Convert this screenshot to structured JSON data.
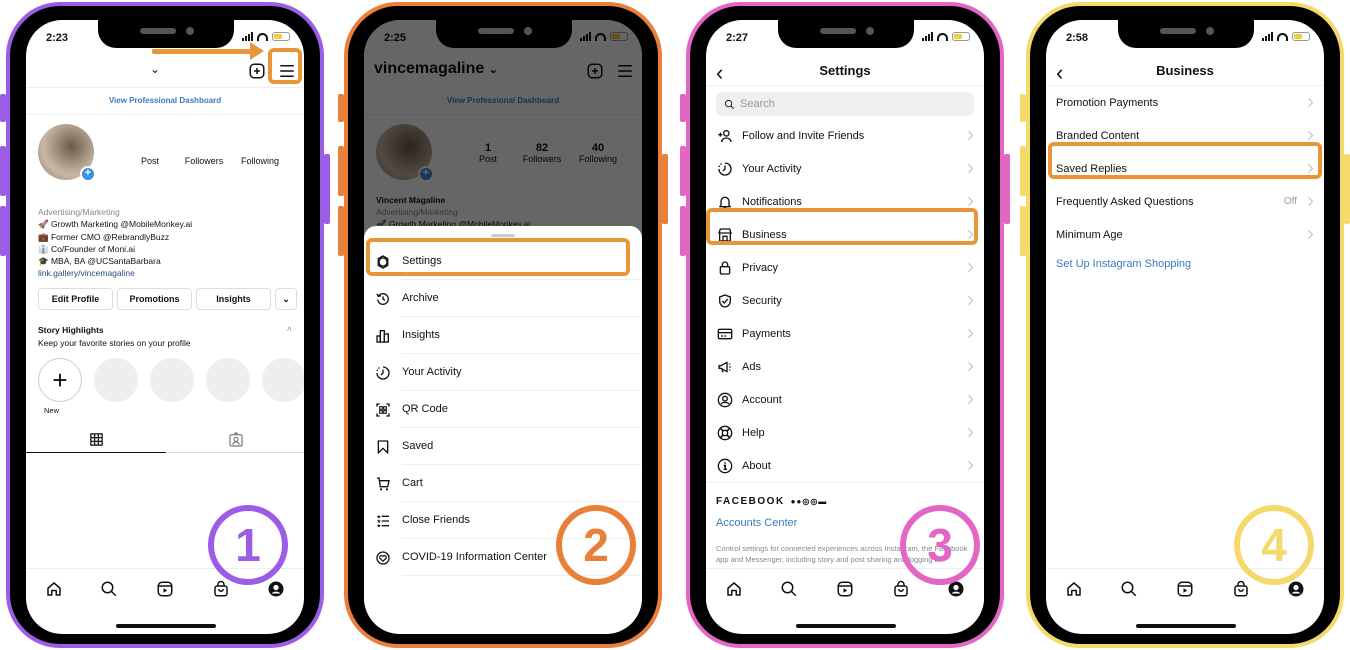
{
  "colors": {
    "step1": "#9b5de5",
    "step2": "#e8803a",
    "step3": "#e466c4",
    "step4": "#f5d96b",
    "highlight": "#e8963a",
    "link": "#3b7bbf"
  },
  "step1": {
    "badge": "1",
    "status_time": "2:23",
    "dashboard_link": "View Professional Dashboard",
    "stats": [
      {
        "label": "Post"
      },
      {
        "label": "Followers"
      },
      {
        "label": "Following"
      }
    ],
    "bio": {
      "category": "Advertising/Marketing",
      "lines": [
        "🚀 Growth Marketing @MobileMonkey.ai",
        "💼 Former CMO @RebrandlyBuzz",
        "👔 Co/Founder of Moni.ai",
        "🎓 MBA, BA @UCSantaBarbara"
      ],
      "link": "link.gallery/vincemagaline"
    },
    "buttons": {
      "edit_profile": "Edit Profile",
      "promotions": "Promotions",
      "insights": "Insights",
      "more": "⌄"
    },
    "highlights": {
      "title": "Story Highlights",
      "subtitle": "Keep your favorite stories on your profile",
      "new_label": "New"
    }
  },
  "step2": {
    "badge": "2",
    "status_time": "2:25",
    "username": "vincemagaline",
    "dashboard_link": "View Professional Dashboard",
    "stats": [
      {
        "value": "1",
        "label": "Post"
      },
      {
        "value": "82",
        "label": "Followers"
      },
      {
        "value": "40",
        "label": "Following"
      }
    ],
    "name": "Vincent Magaline",
    "category": "Advertising/Marketing",
    "bio_line": "🚀 Growth Marketing @MobileMonkey.ai",
    "menu": [
      {
        "label": "Settings",
        "icon": "settings-icon"
      },
      {
        "label": "Archive",
        "icon": "archive-icon"
      },
      {
        "label": "Insights",
        "icon": "insights-icon"
      },
      {
        "label": "Your Activity",
        "icon": "activity-icon"
      },
      {
        "label": "QR Code",
        "icon": "qr-code-icon"
      },
      {
        "label": "Saved",
        "icon": "bookmark-icon"
      },
      {
        "label": "Cart",
        "icon": "cart-icon"
      },
      {
        "label": "Close Friends",
        "icon": "close-friends-icon"
      },
      {
        "label": "COVID-19 Information Center",
        "icon": "covid-info-icon"
      }
    ]
  },
  "step3": {
    "badge": "3",
    "status_time": "2:27",
    "title": "Settings",
    "search_placeholder": "Search",
    "items": [
      {
        "label": "Follow and Invite Friends",
        "icon": "add-person-icon"
      },
      {
        "label": "Your Activity",
        "icon": "activity-icon"
      },
      {
        "label": "Notifications",
        "icon": "bell-icon"
      },
      {
        "label": "Business",
        "icon": "shop-icon"
      },
      {
        "label": "Privacy",
        "icon": "lock-icon"
      },
      {
        "label": "Security",
        "icon": "shield-icon"
      },
      {
        "label": "Payments",
        "icon": "card-icon"
      },
      {
        "label": "Ads",
        "icon": "megaphone-icon"
      },
      {
        "label": "Account",
        "icon": "account-icon"
      },
      {
        "label": "Help",
        "icon": "help-icon"
      },
      {
        "label": "About",
        "icon": "info-icon"
      }
    ],
    "facebook_label": "FACEBOOK",
    "accounts_center": "Accounts Center",
    "accounts_desc": "Control settings for connected experiences across Instagram, the Facebook app and Messenger, including story and post sharing and logging in."
  },
  "step4": {
    "badge": "4",
    "status_time": "2:58",
    "title": "Business",
    "items": [
      {
        "label": "Promotion Payments",
        "value": ""
      },
      {
        "label": "Branded Content",
        "value": ""
      },
      {
        "label": "Saved Replies",
        "value": ""
      },
      {
        "label": "Frequently Asked Questions",
        "value": "Off"
      },
      {
        "label": "Minimum Age",
        "value": ""
      }
    ],
    "shopping_link": "Set Up Instagram Shopping"
  },
  "tabbar": [
    "home-icon",
    "search-icon",
    "reels-icon",
    "shop-icon",
    "profile-icon"
  ]
}
